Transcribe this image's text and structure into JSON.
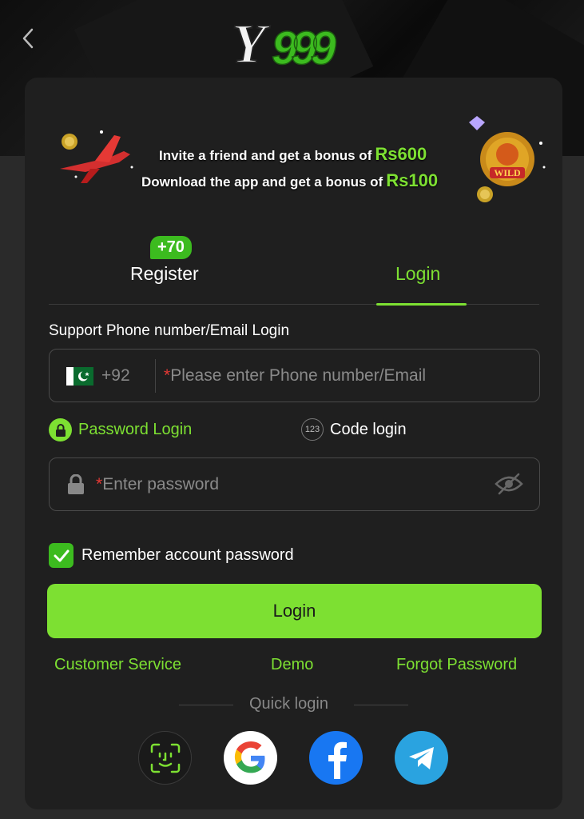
{
  "header": {
    "back_icon": "chevron-left-icon",
    "logo_text": "Y999"
  },
  "banner": {
    "line1_text": "Invite a friend and get a bonus of",
    "line1_amount": "Rs600",
    "line2_text": "Download the app and get a bonus of",
    "line2_amount": "Rs100"
  },
  "tabs": {
    "register_label": "Register",
    "register_badge": "+70",
    "login_label": "Login",
    "active": "Login"
  },
  "form": {
    "support_label": "Support Phone number/Email Login",
    "country_code": "+92",
    "phone_placeholder": "Please enter Phone number/Email",
    "password_login_label": "Password Login",
    "code_login_label": "Code login",
    "code_icon_text": "123",
    "password_placeholder": "Enter password",
    "remember_label": "Remember account password",
    "remember_checked": true,
    "required_mark": "*",
    "submit_label": "Login"
  },
  "links": {
    "customer_service": "Customer Service",
    "demo": "Demo",
    "forgot_password": "Forgot Password"
  },
  "quick_login": {
    "label": "Quick login",
    "providers": [
      "face-id-icon",
      "google-icon",
      "facebook-icon",
      "telegram-icon"
    ]
  },
  "colors": {
    "accent": "#7de032",
    "badge": "#3cbb1f",
    "background": "#1f1f1f",
    "required": "#e53935"
  }
}
